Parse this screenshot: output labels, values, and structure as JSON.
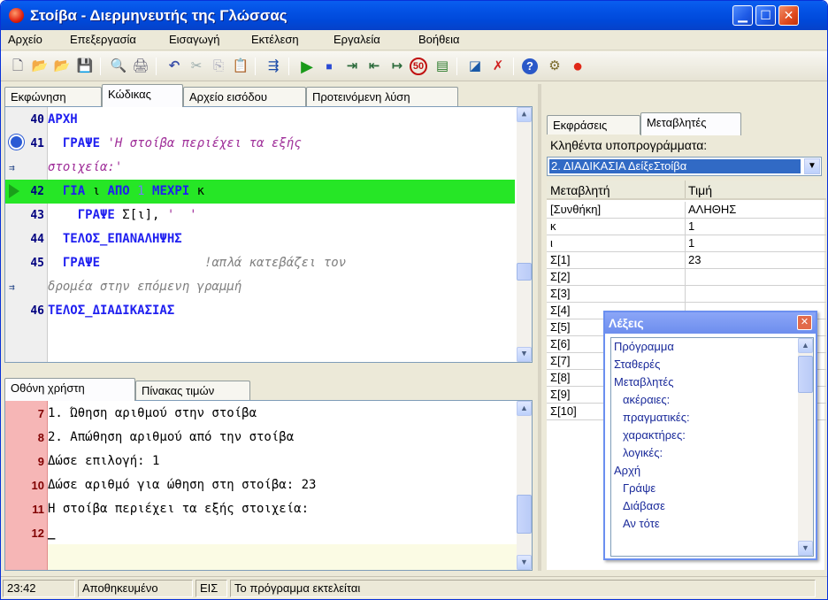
{
  "window": {
    "title": "Στοίβα - Διερμηνευτής της Γλώσσας",
    "minimize": "▁",
    "maximize": "☐",
    "close": "✕"
  },
  "menu": [
    "Αρχείο",
    "Επεξεργασία",
    "Εισαγωγή",
    "Εκτέλεση",
    "Εργαλεία",
    "Βοήθεια"
  ],
  "toolbar_icons": [
    "new-file-icon",
    "open-icon",
    "open-project-icon",
    "save-icon",
    "preview-icon",
    "print-icon",
    "undo-icon",
    "cut-icon",
    "copy-icon",
    "paste-icon",
    "insert-icon",
    "run-icon",
    "stop-icon",
    "step-into-icon",
    "step-over-icon",
    "step-out-icon",
    "run-50-icon",
    "watch-icon",
    "window-icon",
    "clear-icon",
    "help-icon",
    "tools-icon",
    "exit-icon"
  ],
  "toolbar_glyphs": {
    "new": "🗋",
    "open": "📂",
    "open2": "📂",
    "save": "💾",
    "preview": "🔍",
    "print": "🖨",
    "undo": "↶",
    "cut": "✂",
    "copy": "⎘",
    "paste": "📋",
    "insert": "⇶",
    "run": "▶",
    "stop": "■",
    "step1": "⇥",
    "step2": "⇤",
    "step3": "↦",
    "run50": "50",
    "watch": "▤",
    "window": "◪",
    "clear": "✗",
    "help": "?",
    "tools": "⚙",
    "exit": "●"
  },
  "left_tabs": [
    "Εκφώνηση",
    "Κώδικας",
    "Αρχείο εισόδου",
    "Προτεινόμενη λύση"
  ],
  "code_lines": [
    {
      "n": "40",
      "parts": [
        {
          "t": "ΑΡΧΗ",
          "c": "kw"
        }
      ]
    },
    {
      "n": "41",
      "parts": [
        {
          "t": "  ",
          "c": ""
        },
        {
          "t": "ΓΡΑΨΕ",
          "c": "kw"
        },
        {
          "t": " 'Η στοίβα περιέχει τα εξής",
          "c": "str"
        }
      ]
    },
    {
      "n": "",
      "parts": [
        {
          "t": "στοιχεία:'",
          "c": "str"
        }
      ]
    },
    {
      "n": "42",
      "parts": [
        {
          "t": "  ",
          "c": ""
        },
        {
          "t": "ΓΙΑ",
          "c": "kw"
        },
        {
          "t": " ι ",
          "c": ""
        },
        {
          "t": "ΑΠΟ",
          "c": "kw"
        },
        {
          "t": " 1 ",
          "c": "num"
        },
        {
          "t": "ΜΕΧΡΙ",
          "c": "kw"
        },
        {
          "t": " κ",
          "c": ""
        }
      ]
    },
    {
      "n": "43",
      "parts": [
        {
          "t": "    ",
          "c": ""
        },
        {
          "t": "ΓΡΑΨΕ",
          "c": "kw"
        },
        {
          "t": " Σ[ι], ",
          "c": ""
        },
        {
          "t": "'  '",
          "c": "str"
        }
      ]
    },
    {
      "n": "44",
      "parts": [
        {
          "t": "  ",
          "c": ""
        },
        {
          "t": "ΤΕΛΟΣ_ΕΠΑΝΑΛΗΨΗΣ",
          "c": "kw"
        }
      ]
    },
    {
      "n": "45",
      "parts": [
        {
          "t": "  ",
          "c": ""
        },
        {
          "t": "ΓΡΑΨΕ",
          "c": "kw"
        },
        {
          "t": "              !απλά κατεβάζει τον",
          "c": "cmt"
        }
      ]
    },
    {
      "n": "",
      "parts": [
        {
          "t": "δρομέα στην επόμενη γραμμή",
          "c": "cmt"
        }
      ]
    },
    {
      "n": "46",
      "parts": [
        {
          "t": "ΤΕΛΟΣ_ΔΙΑΔΙΚΑΣΙΑΣ",
          "c": "kw"
        }
      ]
    }
  ],
  "bottom_tabs": [
    "Οθόνη χρήστη",
    "Πίνακας τιμών"
  ],
  "output_lines": [
    {
      "n": "7",
      "t": "1. Ώθηση αριθμού στην στοίβα"
    },
    {
      "n": "8",
      "t": "2. Απώθηση αριθμού από την στοίβα"
    },
    {
      "n": "9",
      "t": "Δώσε επιλογή: 1"
    },
    {
      "n": "10",
      "t": "Δώσε αριθμό για ώθηση στη στοίβα: 23"
    },
    {
      "n": "11",
      "t": "Η στοίβα περιέχει τα εξής στοιχεία:"
    },
    {
      "n": "12",
      "t": "_"
    }
  ],
  "right_tabs": [
    "Εκφράσεις",
    "Μεταβλητές"
  ],
  "called_label": "Κληθέντα υποπρογράμματα:",
  "called_selected": "2. ΔΙΑΔΙΚΑΣΙΑ ΔείξεΣτοίβα",
  "var_headers": [
    "Μεταβλητή",
    "Τιμή"
  ],
  "var_rows": [
    {
      "name": "[Συνθήκη]",
      "value": "ΑΛΗΘΗΣ"
    },
    {
      "name": "κ",
      "value": "1"
    },
    {
      "name": "ι",
      "value": "1"
    },
    {
      "name": "Σ[1]",
      "value": "23"
    },
    {
      "name": "Σ[2]",
      "value": ""
    },
    {
      "name": "Σ[3]",
      "value": ""
    },
    {
      "name": "Σ[4]",
      "value": ""
    },
    {
      "name": "Σ[5]",
      "value": ""
    },
    {
      "name": "Σ[6]",
      "value": ""
    },
    {
      "name": "Σ[7]",
      "value": ""
    },
    {
      "name": "Σ[8]",
      "value": ""
    },
    {
      "name": "Σ[9]",
      "value": ""
    },
    {
      "name": "Σ[10]",
      "value": ""
    }
  ],
  "lexeis": {
    "title": "Λέξεις",
    "close": "✕",
    "items": [
      {
        "t": "Πρόγραμμα",
        "i": 0
      },
      {
        "t": "Σταθερές",
        "i": 0
      },
      {
        "t": "Μεταβλητές",
        "i": 0
      },
      {
        "t": "ακέραιες:",
        "i": 1
      },
      {
        "t": "πραγματικές:",
        "i": 1
      },
      {
        "t": "χαρακτήρες:",
        "i": 1
      },
      {
        "t": "λογικές:",
        "i": 1
      },
      {
        "t": "Αρχή",
        "i": 0
      },
      {
        "t": "Γράψε",
        "i": 1
      },
      {
        "t": "Διάβασε",
        "i": 1
      },
      {
        "t": "Αν τότε",
        "i": 1
      }
    ]
  },
  "status": [
    "23:42",
    "Αποθηκευμένο",
    "ΕΙΣ",
    "Το πρόγραμμα εκτελείται"
  ]
}
